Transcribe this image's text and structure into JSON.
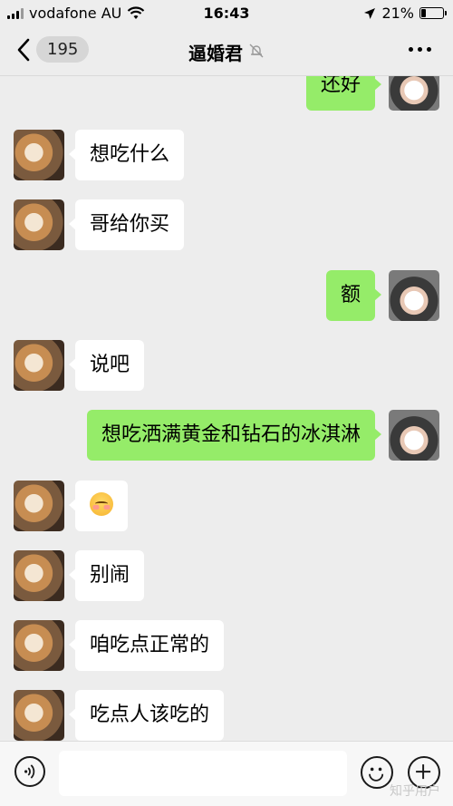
{
  "status_bar": {
    "carrier": "vodafone AU",
    "time": "16:43",
    "battery": "21%",
    "battery_level": 0.21,
    "icons": [
      "signal-icon",
      "wifi-icon",
      "location-arrow-icon",
      "battery-icon"
    ]
  },
  "navbar": {
    "unread_count": "195",
    "title": "逼婚君",
    "icons": [
      "back-chevron-icon",
      "mute-bell-icon",
      "more-dots-icon"
    ]
  },
  "messages": [
    {
      "side": "out",
      "text": "还好"
    },
    {
      "side": "in",
      "text": "想吃什么"
    },
    {
      "side": "in",
      "text": "哥给你买"
    },
    {
      "side": "out",
      "text": "额"
    },
    {
      "side": "in",
      "text": "说吧"
    },
    {
      "side": "out",
      "text": "想吃洒满黄金和钻石的冰淇淋"
    },
    {
      "side": "in",
      "text": "",
      "emoji": "blushing-face-emoji"
    },
    {
      "side": "in",
      "text": "别闹"
    },
    {
      "side": "in",
      "text": "咱吃点正常的"
    },
    {
      "side": "in",
      "text": "吃点人该吃的"
    }
  ],
  "input_bar": {
    "value": "",
    "icons": [
      "voice-icon",
      "emoji-icon",
      "plus-icon"
    ]
  },
  "watermark": "知乎用户",
  "colors": {
    "background": "#ededed",
    "outgoing_bubble": "#95ec69",
    "incoming_bubble": "#ffffff"
  }
}
